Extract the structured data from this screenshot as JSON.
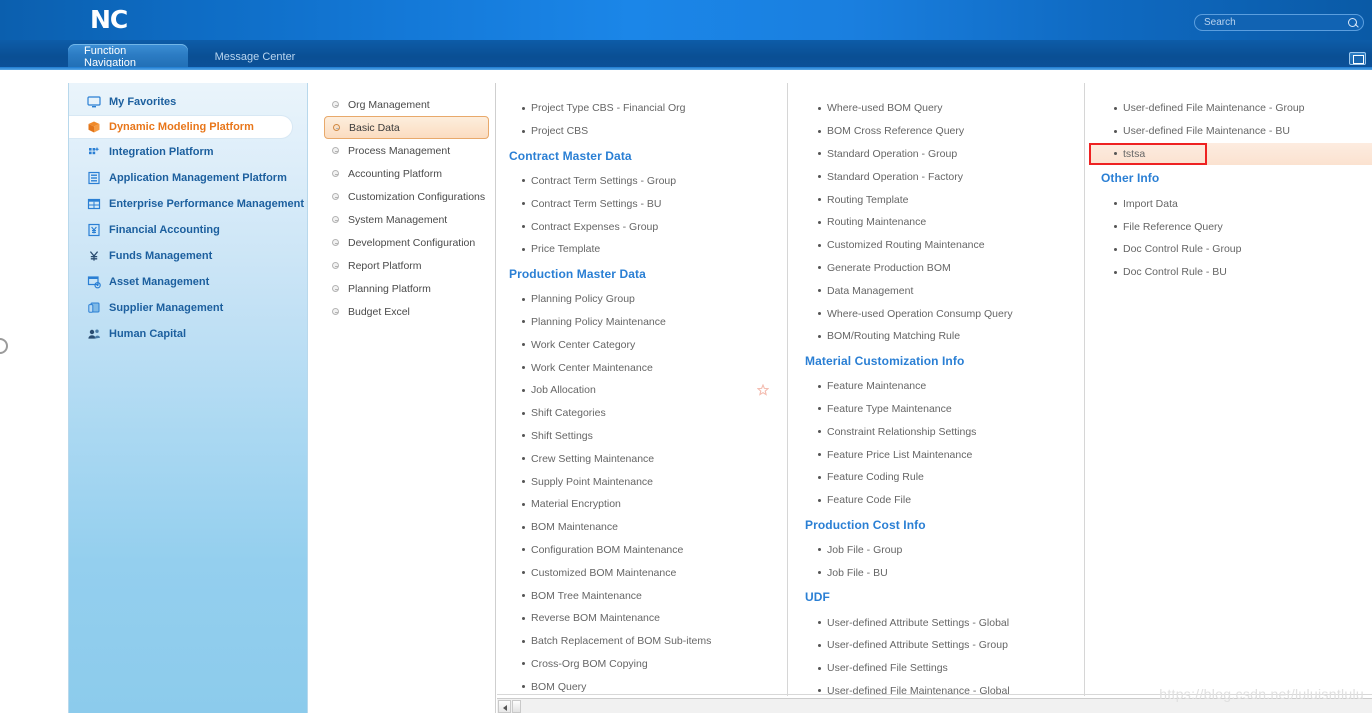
{
  "header": {
    "logo": "NC",
    "search": {
      "placeholder": "Search",
      "value": "",
      "icon": "search-icon"
    },
    "restore_icon": "restore-window-icon"
  },
  "tabs": [
    {
      "label": "Function Navigation",
      "active": true
    },
    {
      "label": "Message Center",
      "active": false
    }
  ],
  "sidebar": {
    "items": [
      {
        "label": "My Favorites",
        "icon": "monitor-icon",
        "active": false
      },
      {
        "label": "Dynamic Modeling Platform",
        "icon": "orange-cube-icon",
        "active": true
      },
      {
        "label": "Integration Platform",
        "icon": "integration-dots-icon",
        "active": false
      },
      {
        "label": "Application Management Platform",
        "icon": "application-building-icon",
        "active": false
      },
      {
        "label": "Enterprise Performance Management",
        "icon": "grid-table-icon",
        "active": false
      },
      {
        "label": "Financial Accounting",
        "icon": "yen-box-icon",
        "active": false
      },
      {
        "label": "Funds Management",
        "icon": "yen-icon",
        "active": false
      },
      {
        "label": "Asset Management",
        "icon": "asset-gear-icon",
        "active": false
      },
      {
        "label": "Supplier Management",
        "icon": "boxes-icon",
        "active": false
      },
      {
        "label": "Human Capital",
        "icon": "people-icon",
        "active": false
      }
    ]
  },
  "modules": {
    "items": [
      {
        "label": "Org Management",
        "active": false
      },
      {
        "label": "Basic Data",
        "active": true
      },
      {
        "label": "Process Management",
        "active": false
      },
      {
        "label": "Accounting Platform",
        "active": false
      },
      {
        "label": "Customization Configurations",
        "active": false
      },
      {
        "label": "System Management",
        "active": false
      },
      {
        "label": "Development Configuration",
        "active": false
      },
      {
        "label": "Report Platform",
        "active": false
      },
      {
        "label": "Planning Platform",
        "active": false
      },
      {
        "label": "Budget Excel",
        "active": false
      }
    ]
  },
  "columns": [
    {
      "blocks": [
        {
          "type": "leaves",
          "items": [
            {
              "label": "Project Type CBS - Financial Org"
            },
            {
              "label": "Project CBS"
            }
          ]
        },
        {
          "type": "group",
          "title": "Contract Master Data",
          "items": [
            {
              "label": "Contract Term Settings - Group"
            },
            {
              "label": "Contract Term Settings - BU"
            },
            {
              "label": "Contract Expenses - Group"
            },
            {
              "label": "Price Template"
            }
          ]
        },
        {
          "type": "group",
          "title": "Production Master Data",
          "items": [
            {
              "label": "Planning Policy Group"
            },
            {
              "label": "Planning Policy Maintenance"
            },
            {
              "label": "Work Center Category"
            },
            {
              "label": "Work Center Maintenance"
            },
            {
              "label": "Job Allocation",
              "star": true
            },
            {
              "label": "Shift Categories"
            },
            {
              "label": "Shift Settings"
            },
            {
              "label": "Crew Setting Maintenance"
            },
            {
              "label": "Supply Point Maintenance"
            },
            {
              "label": "Material Encryption"
            },
            {
              "label": "BOM Maintenance"
            },
            {
              "label": "Configuration BOM Maintenance"
            },
            {
              "label": "Customized BOM Maintenance"
            },
            {
              "label": "BOM Tree Maintenance"
            },
            {
              "label": "Reverse BOM Maintenance"
            },
            {
              "label": "Batch Replacement of BOM Sub-items"
            },
            {
              "label": "Cross-Org BOM Copying"
            },
            {
              "label": "BOM Query"
            }
          ]
        }
      ]
    },
    {
      "blocks": [
        {
          "type": "leaves",
          "items": [
            {
              "label": "Where-used BOM Query"
            },
            {
              "label": "BOM Cross Reference Query"
            },
            {
              "label": "Standard Operation - Group"
            },
            {
              "label": "Standard Operation - Factory"
            },
            {
              "label": "Routing Template"
            },
            {
              "label": "Routing Maintenance"
            },
            {
              "label": "Customized Routing Maintenance"
            },
            {
              "label": "Generate Production BOM"
            },
            {
              "label": "Data Management"
            },
            {
              "label": "Where-used Operation Consump Query"
            },
            {
              "label": "BOM/Routing Matching Rule"
            }
          ]
        },
        {
          "type": "group",
          "title": "Material Customization Info",
          "items": [
            {
              "label": "Feature Maintenance"
            },
            {
              "label": "Feature Type Maintenance"
            },
            {
              "label": "Constraint Relationship Settings"
            },
            {
              "label": "Feature Price List Maintenance"
            },
            {
              "label": "Feature Coding Rule"
            },
            {
              "label": "Feature Code File"
            }
          ]
        },
        {
          "type": "group",
          "title": "Production Cost Info",
          "items": [
            {
              "label": "Job File - Group"
            },
            {
              "label": "Job File - BU"
            }
          ]
        },
        {
          "type": "group",
          "title": "UDF",
          "items": [
            {
              "label": "User-defined Attribute Settings - Global"
            },
            {
              "label": "User-defined Attribute Settings - Group"
            },
            {
              "label": "User-defined File Settings"
            },
            {
              "label": "User-defined File Maintenance - Global"
            }
          ]
        }
      ]
    },
    {
      "blocks": [
        {
          "type": "leaves",
          "items": [
            {
              "label": "User-defined File Maintenance - Group"
            },
            {
              "label": "User-defined File Maintenance - BU"
            },
            {
              "label": "tstsa",
              "highlight": true,
              "annotated": true
            }
          ]
        },
        {
          "type": "group",
          "title": "Other Info",
          "items": [
            {
              "label": "Import Data"
            },
            {
              "label": "File Reference Query"
            },
            {
              "label": "Doc Control Rule - Group"
            },
            {
              "label": "Doc Control Rule - BU"
            }
          ]
        }
      ]
    }
  ],
  "scrollbar": {
    "left_arrow_icon": "scroll-left-arrow-icon"
  },
  "watermark": "https://blog.csdn.net/luluisntlulu",
  "colors": {
    "brand_blue": "#1479d8",
    "group_header_blue": "#2a7fd4",
    "active_module_orange": "#e8a96b",
    "active_nav_text": "#e8761a",
    "annotation_red": "#ee2222",
    "highlight_peach": "#fbe2d0"
  }
}
